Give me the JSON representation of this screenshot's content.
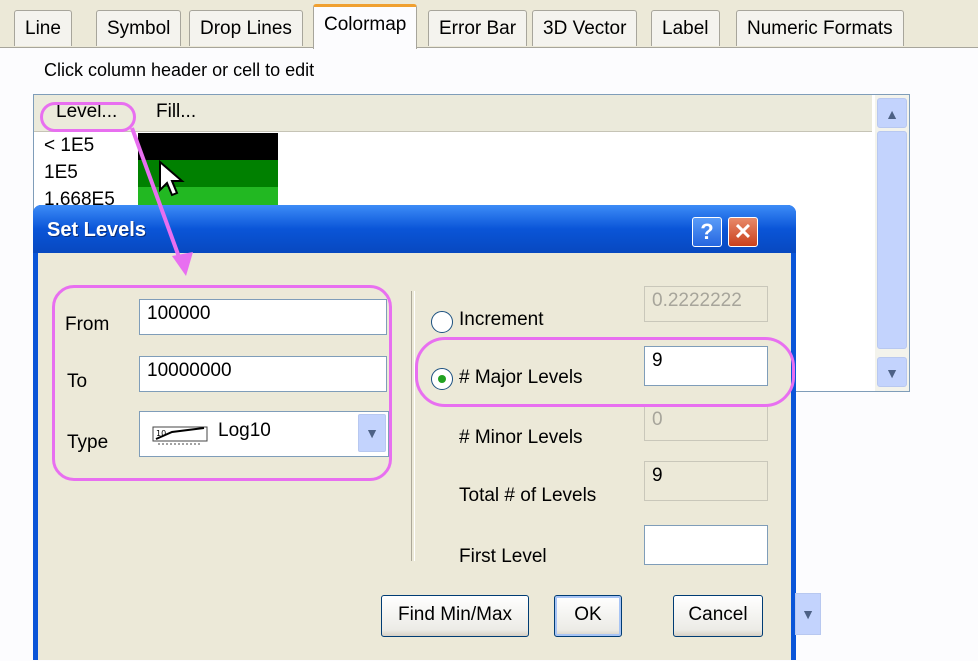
{
  "tabs": [
    "Line",
    "Symbol",
    "Drop Lines",
    "Colormap",
    "Error Bar",
    "3D Vector",
    "Label",
    "Numeric Formats"
  ],
  "active_tab": "Colormap",
  "hint": "Click column header or cell to edit",
  "grid": {
    "columns": [
      "Level...",
      "Fill..."
    ],
    "rows": [
      {
        "level": "< 1E5",
        "fill": "#000000"
      },
      {
        "level": "1E5",
        "fill": "#008000"
      },
      {
        "level": "1.668E5",
        "fill": "#22b822"
      }
    ]
  },
  "dialog": {
    "title": "Set Levels",
    "help_label": "?",
    "close_label": "✕",
    "from_label": "From",
    "from_value": "100000",
    "to_label": "To",
    "to_value": "10000000",
    "type_label": "Type",
    "type_value": "Log10",
    "increment_label": "Increment",
    "increment_value": "0.2222222",
    "major_label": "# Major Levels",
    "major_value": "9",
    "minor_label": "# Minor Levels",
    "minor_value": "0",
    "total_label": "Total # of Levels",
    "total_value": "9",
    "first_label": "First Level",
    "first_value": "",
    "selected_mode": "major_levels",
    "buttons": {
      "findminmax": "Find Min/Max",
      "ok": "OK",
      "cancel": "Cancel"
    }
  },
  "colors": {
    "highlight": "#e86ff0",
    "titlebar": "#0a55d8"
  }
}
